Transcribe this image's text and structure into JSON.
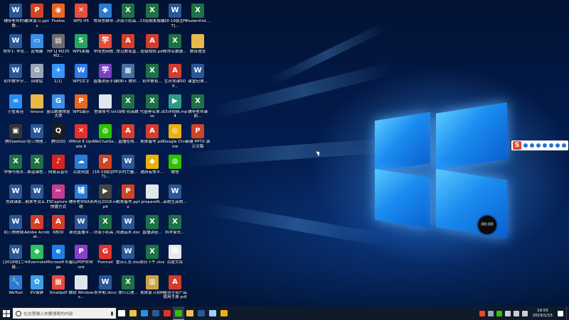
{
  "desktop_icons": [
    {
      "label": "辅导老师的奇数...",
      "col": 0,
      "row": 0,
      "icon": "word-doc-icon",
      "color": "#2b5797",
      "glyph": "W"
    },
    {
      "label": "期末复习.pptx",
      "col": 1,
      "row": 0,
      "icon": "ppt-file-icon",
      "color": "#d04423",
      "glyph": "P"
    },
    {
      "label": "Firefox",
      "col": 2,
      "row": 0,
      "icon": "firefox-icon",
      "color": "#e8661f",
      "glyph": "◉"
    },
    {
      "label": "WPS H5",
      "col": 3,
      "row": 0,
      "icon": "wps-h5-icon",
      "color": "#e84c3d",
      "glyph": "✕"
    },
    {
      "label": "常用思维导...",
      "col": 4,
      "row": 0,
      "icon": "app-icon",
      "color": "#2a7bd6",
      "glyph": "◆"
    },
    {
      "label": "济南小初高...",
      "col": 5,
      "row": 0,
      "icon": "excel-file-icon",
      "color": "#1e7145",
      "glyph": "X"
    },
    {
      "label": "13班期末成绩",
      "col": 6,
      "row": 0,
      "icon": "excel-file-icon",
      "color": "#1e7145",
      "glyph": "X"
    },
    {
      "label": "[18-19版][PPT]...",
      "col": 7,
      "row": 0,
      "icon": "word-doc-icon",
      "color": "#2b5797",
      "glyph": "W"
    },
    {
      "label": "studentlist...",
      "col": 8,
      "row": 0,
      "icon": "excel-file-icon",
      "color": "#1e7145",
      "glyph": "X"
    },
    {
      "label": "附件1: 学员...",
      "col": 0,
      "row": 1,
      "icon": "word-doc-icon",
      "color": "#2b5797",
      "glyph": "W"
    },
    {
      "label": "此电脑",
      "col": 1,
      "row": 1,
      "icon": "this-pc-icon",
      "color": "#3a8ee6",
      "glyph": "▭"
    },
    {
      "label": "HP LJ M225M2...",
      "col": 2,
      "row": 1,
      "icon": "printer-icon",
      "color": "#6b6b6b",
      "glyph": "▤"
    },
    {
      "label": "WPS表格",
      "col": 3,
      "row": 1,
      "icon": "wps-sheet-icon",
      "color": "#25a55f",
      "glyph": "S"
    },
    {
      "label": "学而思网校...",
      "col": 4,
      "row": 1,
      "icon": "app-icon",
      "color": "#e84c3d",
      "glyph": "学"
    },
    {
      "label": "常见教育直...",
      "col": 5,
      "row": 1,
      "icon": "pdf-file-icon",
      "color": "#d43c2c",
      "glyph": "A"
    },
    {
      "label": "班级规则.pdf",
      "col": 6,
      "row": 1,
      "icon": "pdf-file-icon",
      "color": "#d43c2c",
      "glyph": "A"
    },
    {
      "label": "未命名数据...",
      "col": 7,
      "row": 1,
      "icon": "excel-file-icon",
      "color": "#1e7145",
      "glyph": "X"
    },
    {
      "label": "教育理念",
      "col": 8,
      "row": 1,
      "icon": "folder-icon",
      "color": "#e8b84a",
      "glyph": ""
    },
    {
      "label": "初中数学分...",
      "col": 0,
      "row": 2,
      "icon": "word-doc-icon",
      "color": "#2b5797",
      "glyph": "W"
    },
    {
      "label": "回收站",
      "col": 1,
      "row": 2,
      "icon": "recycle-bin-icon",
      "color": "#9aa6b4",
      "glyph": "♻"
    },
    {
      "label": "钉钉",
      "col": 2,
      "row": 2,
      "icon": "dingtalk-icon",
      "color": "#3296fa",
      "glyph": "✈"
    },
    {
      "label": "WPS文字",
      "col": 3,
      "row": 2,
      "icon": "wps-writer-icon",
      "color": "#2f7ae5",
      "glyph": "W"
    },
    {
      "label": "直播讲座平台",
      "col": 4,
      "row": 2,
      "icon": "app-icon",
      "color": "#7b3fc4",
      "glyph": "学"
    },
    {
      "label": "树邦+ 教师...",
      "col": 5,
      "row": 2,
      "icon": "app-icon",
      "color": "#4a6fa5",
      "glyph": "▦"
    },
    {
      "label": "初中教育...",
      "col": 6,
      "row": 2,
      "icon": "excel-file-icon",
      "color": "#1e7145",
      "glyph": "X"
    },
    {
      "label": "生评党课SOP...",
      "col": 7,
      "row": 2,
      "icon": "pdf-file-icon",
      "color": "#d43c2c",
      "glyph": "A"
    },
    {
      "label": "课堂纪律...",
      "col": 8,
      "row": 2,
      "icon": "word-doc-icon",
      "color": "#2b5797",
      "glyph": "W"
    },
    {
      "label": "小鱼易连",
      "col": 0,
      "row": 3,
      "icon": "xiaoyu-icon",
      "color": "#2d8cf0",
      "glyph": "∞"
    },
    {
      "label": "lenovo",
      "col": 1,
      "row": 3,
      "icon": "folder-icon",
      "color": "#e8b84a",
      "glyph": ""
    },
    {
      "label": "金山数据恢复大师",
      "col": 2,
      "row": 3,
      "icon": "recovery-icon",
      "color": "#3a8ee6",
      "glyph": "G"
    },
    {
      "label": "WPS演示",
      "col": 3,
      "row": 3,
      "icon": "wps-present-icon",
      "color": "#e8661f",
      "glyph": "P"
    },
    {
      "label": "登录账号.txt",
      "col": 4,
      "row": 3,
      "icon": "text-file-icon",
      "color": "#dfe6ee",
      "glyph": ""
    },
    {
      "label": "四校-初高数",
      "col": 5,
      "row": 3,
      "icon": "excel-file-icon",
      "color": "#1e7145",
      "glyph": "X"
    },
    {
      "label": "代金券名单.xlsx",
      "col": 6,
      "row": 3,
      "icon": "excel-file-icon",
      "color": "#1e7145",
      "glyph": "X"
    },
    {
      "label": "15评视频.mp4",
      "col": 7,
      "row": 3,
      "icon": "video-file-icon",
      "color": "#2e9a8a",
      "glyph": "▶"
    },
    {
      "label": "辅导老师课前...",
      "col": 8,
      "row": 3,
      "icon": "excel-file-icon",
      "color": "#1e7145",
      "glyph": "X"
    },
    {
      "label": "腾讯wetool",
      "col": 0,
      "row": 4,
      "icon": "wetool-icon",
      "color": "#333333",
      "glyph": "▣"
    },
    {
      "label": "初三物理...",
      "col": 1,
      "row": 4,
      "icon": "word-doc-icon",
      "color": "#2b5797",
      "glyph": "W"
    },
    {
      "label": "腾讯QQ",
      "col": 2,
      "row": 4,
      "icon": "qq-icon",
      "color": "#1d1d1d",
      "glyph": "Q"
    },
    {
      "label": "XMind 8 Update 6",
      "col": 3,
      "row": 4,
      "icon": "xmind-icon",
      "color": "#e4312b",
      "glyph": "✕"
    },
    {
      "label": "WeChatSe...",
      "col": 4,
      "row": 4,
      "icon": "wechat-icon",
      "color": "#2dc100",
      "glyph": "◍"
    },
    {
      "label": "直播在线...",
      "col": 5,
      "row": 4,
      "icon": "pdf-file-icon",
      "color": "#d43c2c",
      "glyph": "A"
    },
    {
      "label": "期末备考.pdf",
      "col": 6,
      "row": 4,
      "icon": "pdf-file-icon",
      "color": "#d43c2c",
      "glyph": "A"
    },
    {
      "label": "Google Chrome",
      "col": 7,
      "row": 4,
      "icon": "chrome-icon",
      "color": "#e8b20e",
      "glyph": "◎"
    },
    {
      "label": "新建 PPTX 演示文稿",
      "col": 8,
      "row": 4,
      "icon": "ppt-file-icon",
      "color": "#d04423",
      "glyph": "P"
    },
    {
      "label": "学情与成长...",
      "col": 0,
      "row": 5,
      "icon": "excel-file-icon",
      "color": "#1e7145",
      "glyph": "X"
    },
    {
      "label": "渠道课程...",
      "col": 1,
      "row": 5,
      "icon": "excel-file-icon",
      "color": "#1e7145",
      "glyph": "X"
    },
    {
      "label": "网易云音乐",
      "col": 2,
      "row": 5,
      "icon": "netease-music-icon",
      "color": "#d8241f",
      "glyph": "♪"
    },
    {
      "label": "百度网盘",
      "col": 3,
      "row": 5,
      "icon": "baidu-pan-icon",
      "color": "#2a7bd6",
      "glyph": "☁"
    },
    {
      "label": "[18-19版][PPT]...",
      "col": 4,
      "row": 5,
      "icon": "ppt-file-icon",
      "color": "#d04423",
      "glyph": "P"
    },
    {
      "label": "农村力量...",
      "col": 5,
      "row": 5,
      "icon": "word-doc-icon",
      "color": "#2b5797",
      "glyph": "W"
    },
    {
      "label": "通用有效平...",
      "col": 6,
      "row": 5,
      "icon": "app-icon",
      "color": "#e8b20e",
      "glyph": "◆"
    },
    {
      "label": "微信",
      "col": 7,
      "row": 5,
      "icon": "wechat-icon",
      "color": "#2dc100",
      "glyph": "◍"
    },
    {
      "label": "思政课家...",
      "col": 0,
      "row": 6,
      "icon": "word-doc-icon",
      "color": "#2b5797",
      "glyph": "W"
    },
    {
      "label": "期末考试五...",
      "col": 1,
      "row": 6,
      "icon": "word-doc-icon",
      "color": "#2b5797",
      "glyph": "W"
    },
    {
      "label": "FSCapture - 快捷方式",
      "col": 2,
      "row": 6,
      "icon": "fscapture-icon",
      "color": "#c83a8e",
      "glyph": "✂"
    },
    {
      "label": "辅导老师KA系统",
      "col": 3,
      "row": 6,
      "icon": "app-icon",
      "color": "#2a7bd6",
      "glyph": "辅"
    },
    {
      "label": "再见2018.mp4",
      "col": 4,
      "row": 6,
      "icon": "video-file-icon",
      "color": "#444444",
      "glyph": "▶"
    },
    {
      "label": "期末备考.pptx",
      "col": 5,
      "row": 6,
      "icon": "ppt-file-icon",
      "color": "#d04423",
      "glyph": "P"
    },
    {
      "label": "prepareN...",
      "col": 6,
      "row": 6,
      "icon": "text-file-icon",
      "color": "#dfe6ee",
      "glyph": ""
    },
    {
      "label": "高校生高校...",
      "col": 7,
      "row": 6,
      "icon": "word-doc-icon",
      "color": "#2b5797",
      "glyph": "W"
    },
    {
      "label": "初三物理期...",
      "col": 0,
      "row": 7,
      "icon": "word-doc-icon",
      "color": "#2b5797",
      "glyph": "W"
    },
    {
      "label": "Adobe Acrobat...",
      "col": 1,
      "row": 7,
      "icon": "acrobat-icon",
      "color": "#d43c2c",
      "glyph": "A"
    },
    {
      "label": "KBOX",
      "col": 2,
      "row": 7,
      "icon": "pdf-file-icon",
      "color": "#d43c2c",
      "glyph": "A"
    },
    {
      "label": "新班直播平...",
      "col": 3,
      "row": 7,
      "icon": "word-doc-icon",
      "color": "#2b5797",
      "glyph": "W"
    },
    {
      "label": "济南小初高...",
      "col": 4,
      "row": 7,
      "icon": "excel-file-icon",
      "color": "#1e7145",
      "glyph": "X"
    },
    {
      "label": "沟通话术.doc",
      "col": 5,
      "row": 7,
      "icon": "word-doc-icon",
      "color": "#2b5797",
      "glyph": "W"
    },
    {
      "label": "直播讲座...",
      "col": 6,
      "row": 7,
      "icon": "excel-file-icon",
      "color": "#1e7145",
      "glyph": "X"
    },
    {
      "label": "科学家长...",
      "col": 7,
      "row": 7,
      "icon": "excel-file-icon",
      "color": "#1e7145",
      "glyph": "X"
    },
    {
      "label": "[2018秋]二年级...",
      "col": 0,
      "row": 8,
      "icon": "word-doc-icon",
      "color": "#2b5797",
      "glyph": "W"
    },
    {
      "label": "Evernote",
      "col": 1,
      "row": 8,
      "icon": "evernote-icon",
      "color": "#2dbe60",
      "glyph": "◆"
    },
    {
      "label": "Microsoft Edge",
      "col": 2,
      "row": 8,
      "icon": "edge-icon",
      "color": "#1e7ee6",
      "glyph": "e"
    },
    {
      "label": "金山PDF转Word",
      "col": 3,
      "row": 8,
      "icon": "pdf-convert-icon",
      "color": "#8a3ec9",
      "glyph": "P"
    },
    {
      "label": "Foxmail",
      "col": 4,
      "row": 8,
      "icon": "foxmail-icon",
      "color": "#e4312b",
      "glyph": "G"
    },
    {
      "label": "重点汇总.doc",
      "col": 5,
      "row": 8,
      "icon": "word-doc-icon",
      "color": "#2b5797",
      "glyph": "W"
    },
    {
      "label": "周日下午.xlsx",
      "col": 6,
      "row": 8,
      "icon": "excel-file-icon",
      "color": "#1e7145",
      "glyph": "X"
    },
    {
      "label": "百度文库",
      "col": 7,
      "row": 8,
      "icon": "baidu-wenku-icon",
      "color": "#e8e8e8",
      "glyph": "库"
    },
    {
      "label": "WeTool",
      "col": 0,
      "row": 9,
      "icon": "wetool-icon",
      "color": "#2a7bd6",
      "glyph": "🔧"
    },
    {
      "label": "EV录屏",
      "col": 1,
      "row": 9,
      "icon": "ev-recorder-icon",
      "color": "#3aa0e8",
      "glyph": "✿"
    },
    {
      "label": "Smallpdf",
      "col": 2,
      "row": 9,
      "icon": "smallpdf-icon",
      "color": "#e84c3d",
      "glyph": "▦"
    },
    {
      "label": "微软 Windows...",
      "col": 3,
      "row": 9,
      "icon": "windows-file-icon",
      "color": "#dfe6ee",
      "glyph": ""
    },
    {
      "label": "表学期.docx",
      "col": 4,
      "row": 9,
      "icon": "word-doc-icon",
      "color": "#2b5797",
      "glyph": "W"
    },
    {
      "label": "旅行心理...",
      "col": 5,
      "row": 9,
      "icon": "excel-file-icon",
      "color": "#1e7145",
      "glyph": "X"
    },
    {
      "label": "期末复习资料",
      "col": 6,
      "row": 9,
      "icon": "archive-icon",
      "color": "#c9a548",
      "glyph": "▥"
    },
    {
      "label": "易词平台产品使用手册.pdf",
      "col": 7,
      "row": 9,
      "icon": "pdf-file-icon",
      "color": "#d43c2c",
      "glyph": "A"
    }
  ],
  "recorder": {
    "time": "00:00"
  },
  "ime_toolbar": {
    "logo": "S"
  },
  "taskbar": {
    "search_placeholder": "在这里输入你要搜索的内容",
    "pinned": [
      {
        "name": "task-view-icon",
        "color": "#ffffff"
      },
      {
        "name": "file-explorer-icon",
        "color": "#f2c04a"
      },
      {
        "name": "edge-icon",
        "color": "#2f8fe6"
      },
      {
        "name": "word-icon",
        "color": "#2b5797"
      },
      {
        "name": "foxmail-icon",
        "color": "#e4312b"
      },
      {
        "name": "wechat-icon",
        "color": "#2dc100"
      },
      {
        "name": "folder-icon",
        "color": "#f2c04a"
      },
      {
        "name": "word-icon",
        "color": "#2b5797"
      },
      {
        "name": "photos-icon",
        "color": "#9bd0ff"
      },
      {
        "name": "chrome-icon",
        "color": "#e8b20e"
      }
    ],
    "clock_time": "19:55",
    "clock_date": "2019/1/15"
  }
}
